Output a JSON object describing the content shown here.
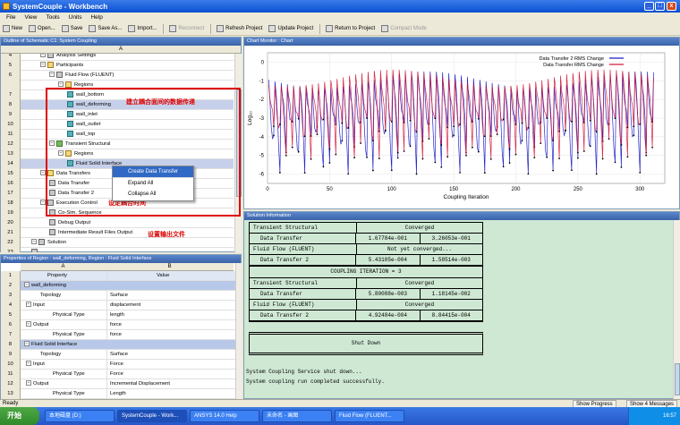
{
  "window": {
    "title": "SystemCouple - Workbench"
  },
  "menu": [
    "File",
    "View",
    "Tools",
    "Units",
    "Help"
  ],
  "toolbar": [
    {
      "label": "New",
      "icon": "new-icon",
      "enabled": true
    },
    {
      "label": "Open...",
      "icon": "open-icon",
      "enabled": true
    },
    {
      "label": "Save",
      "icon": "save-icon",
      "enabled": true
    },
    {
      "label": "Save As...",
      "icon": "save-as-icon",
      "enabled": true
    },
    {
      "label": "Import...",
      "icon": "import-icon",
      "enabled": true
    },
    {
      "label": "Reconnect",
      "icon": "reconnect-icon",
      "enabled": false
    },
    {
      "label": "Refresh Project",
      "icon": "refresh-icon",
      "enabled": true
    },
    {
      "label": "Update Project",
      "icon": "update-icon",
      "enabled": true
    },
    {
      "label": "Return to Project",
      "icon": "return-icon",
      "enabled": true
    },
    {
      "label": "Compact Mode",
      "icon": "compact-icon",
      "enabled": false
    }
  ],
  "outline": {
    "title": "Outline of Schematic C1: System Coupling",
    "column": "A",
    "rows": [
      {
        "n": "4",
        "label": "Analysis Settings",
        "indent": 2,
        "icon": "gear"
      },
      {
        "n": "5",
        "label": "Participants",
        "indent": 2,
        "icon": "fold"
      },
      {
        "n": "6",
        "label": "Fluid Flow (FLUENT)",
        "indent": 3,
        "icon": "fluid"
      },
      {
        "n": "",
        "label": "Regions",
        "indent": 4,
        "icon": "fold"
      },
      {
        "n": "7",
        "label": "wall_bottom",
        "indent": 5,
        "icon": "face"
      },
      {
        "n": "8",
        "label": "wall_deforming",
        "indent": 5,
        "icon": "face",
        "selected": true
      },
      {
        "n": "9",
        "label": "wall_inlet",
        "indent": 5,
        "icon": "face"
      },
      {
        "n": "10",
        "label": "wall_outlet",
        "indent": 5,
        "icon": "face"
      },
      {
        "n": "11",
        "label": "wall_top",
        "indent": 5,
        "icon": "face"
      },
      {
        "n": "12",
        "label": "Transient Structural",
        "indent": 3,
        "icon": "ts"
      },
      {
        "n": "13",
        "label": "Regions",
        "indent": 4,
        "icon": "fold"
      },
      {
        "n": "14",
        "label": "Fluid Solid Interface",
        "indent": 5,
        "icon": "face",
        "selected": true
      },
      {
        "n": "15",
        "label": "Data Transfers",
        "indent": 2,
        "icon": "fold"
      },
      {
        "n": "16",
        "label": "Data Transfer",
        "indent": 3,
        "icon": "dt"
      },
      {
        "n": "17",
        "label": "Data Transfer 2",
        "indent": 3,
        "icon": "dt"
      },
      {
        "n": "18",
        "label": "Execution Control",
        "indent": 2,
        "icon": "gear"
      },
      {
        "n": "19",
        "label": "Co-Sim. Sequence",
        "indent": 3,
        "icon": "dt"
      },
      {
        "n": "20",
        "label": "Debug Output",
        "indent": 3,
        "icon": "dt"
      },
      {
        "n": "21",
        "label": "Intermediate Result Files Output",
        "indent": 3,
        "icon": "dt"
      },
      {
        "n": "22",
        "label": "Solution",
        "indent": 1,
        "icon": "gear"
      },
      {
        "n": "23",
        "label": "",
        "indent": 1,
        "icon": "dt"
      }
    ],
    "annotations": [
      "建立耦合面间的数据传递",
      "设定耦合时间",
      "设置输出文件"
    ]
  },
  "context_menu": [
    "Create Data Transfer",
    "Expand All",
    "Collapse All"
  ],
  "properties": {
    "title": "Properties of Region : wall_deforming, Region : Fluid Solid Interface",
    "columns": [
      "A",
      "B"
    ],
    "col_labels": [
      "Property",
      "Value"
    ],
    "rows": [
      {
        "n": "1",
        "prop": "Property",
        "value": "Value",
        "header": true
      },
      {
        "n": "2",
        "prop": "wall_deforming",
        "value": "",
        "section": true
      },
      {
        "n": "3",
        "prop": "Topology",
        "value": "Surface"
      },
      {
        "n": "4",
        "prop": "Input",
        "value": "displacement",
        "expander": true
      },
      {
        "n": "5",
        "prop": "Physical Type",
        "value": "length",
        "sub": true
      },
      {
        "n": "6",
        "prop": "Output",
        "value": "force",
        "expander": true
      },
      {
        "n": "7",
        "prop": "Physical Type",
        "value": "force",
        "sub": true
      },
      {
        "n": "8",
        "prop": "Fluid Solid Interface",
        "value": "",
        "section": true
      },
      {
        "n": "9",
        "prop": "Topology",
        "value": "Surface"
      },
      {
        "n": "10",
        "prop": "Input",
        "value": "Force",
        "expander": true
      },
      {
        "n": "11",
        "prop": "Physical Type",
        "value": "Force",
        "sub": true
      },
      {
        "n": "12",
        "prop": "Output",
        "value": "Incremental Displacement",
        "expander": true
      },
      {
        "n": "13",
        "prop": "Physical Type",
        "value": "Length",
        "sub": true
      }
    ]
  },
  "chart": {
    "panel_title": "Chart Monitor : Chart",
    "legend": [
      "Data Transfer 2 RMS Change",
      "Data Transfer RMS Change"
    ],
    "colors": {
      "series1": "#1010c8",
      "series2": "#d01030"
    }
  },
  "chart_data": {
    "type": "line",
    "title": "",
    "xlabel": "Coupling Iteration",
    "ylabel": "Log₁₀",
    "xlim": [
      0,
      320
    ],
    "ylim": [
      -6.5,
      0.5
    ],
    "xticks": [
      0,
      50,
      100,
      150,
      200,
      250,
      300
    ],
    "yticks": [
      0,
      -1,
      -2,
      -3,
      -4,
      -5,
      -6
    ],
    "series": [
      {
        "name": "Data Transfer 2 RMS Change",
        "pattern": "oscillating",
        "cycle_length": 5,
        "peak_range": [
          -1.4,
          -0.5
        ],
        "trough_range": [
          -6.0,
          -3.2
        ]
      },
      {
        "name": "Data Transfer RMS Change",
        "pattern": "oscillating",
        "cycle_length": 5,
        "peak_range": [
          -1.3,
          -0.4
        ],
        "trough_range": [
          -5.2,
          -3.0
        ]
      }
    ]
  },
  "solution": {
    "panel_title": "Solution Information",
    "table1": [
      [
        "Transient Structural",
        "Converged",
        ""
      ],
      [
        "Data Transfer",
        "1.67784e-001",
        "3.26053e-001"
      ],
      [
        "Fluid Flow (FLUENT)",
        "Not yet converged...",
        ""
      ],
      [
        "Data Transfer 2",
        "5.43105e-004",
        "1.58514e-003"
      ]
    ],
    "iteration_line": "COUPLING ITERATION = 3",
    "table2": [
      [
        "Transient Structural",
        "Converged",
        ""
      ],
      [
        "Data Transfer",
        "5.80088e-003",
        "1.18145e-002"
      ],
      [
        "Fluid Flow (FLUENT)",
        "Converged",
        ""
      ],
      [
        "Data Transfer 2",
        "4.92484e-004",
        "8.84415e-004"
      ]
    ],
    "shutdown": "Shut Down",
    "log": [
      "System Coupling Service shut down...",
      "System coupling run completed successfully."
    ]
  },
  "status": {
    "text": "Ready",
    "show_progress": "Show Progress",
    "show_messages": "Show 4 Messages"
  },
  "taskbar": {
    "start": "开始",
    "items": [
      "本地磁盘 (D:)",
      "SystemCouple - Work...",
      "ANSYS 14.0 Help",
      "未命名 - 画图",
      "Fluid Flow (FLUENT..."
    ],
    "clock": "16:57"
  }
}
